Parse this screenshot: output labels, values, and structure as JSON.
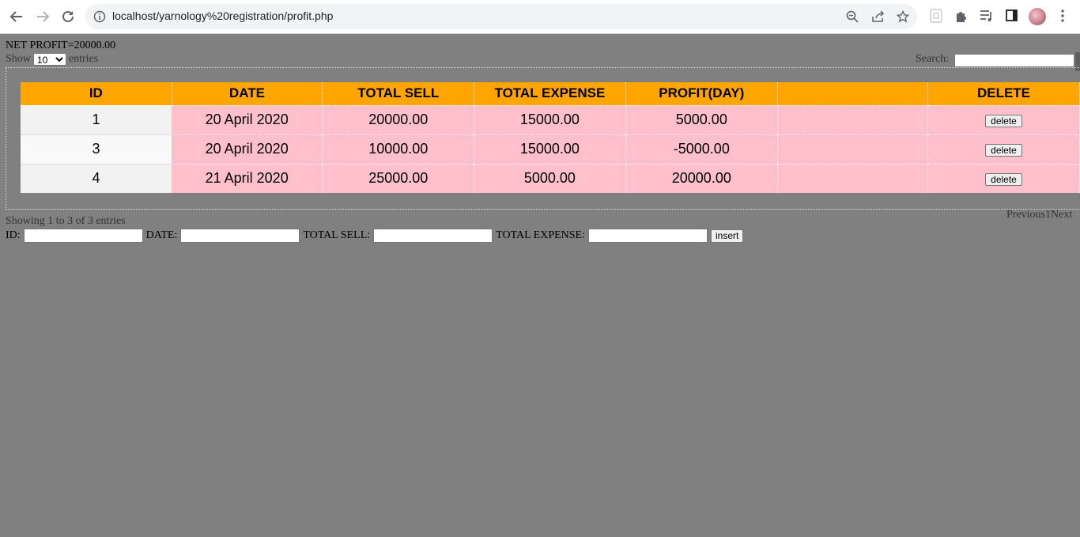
{
  "browser": {
    "url": "localhost/yarnology%20registration/profit.php"
  },
  "page": {
    "net_profit": "NET PROFIT=20000.00",
    "show_label": "Show",
    "show_value": "10",
    "entries_label": "entries",
    "search_label": "Search:",
    "search_value": "",
    "showing_text": "Showing 1 to 3 of 3 entries",
    "paginate": {
      "previous": "Previous",
      "page": "1",
      "next": "Next"
    }
  },
  "table": {
    "headers": [
      "ID",
      "DATE",
      "TOTAL SELL",
      "TOTAL EXPENSE",
      "PROFIT(DAY)",
      "",
      "DELETE"
    ],
    "rows": [
      {
        "id": "1",
        "date": "20 April 2020",
        "sell": "20000.00",
        "expense": "15000.00",
        "profit": "5000.00",
        "delete": "delete"
      },
      {
        "id": "3",
        "date": "20 April 2020",
        "sell": "10000.00",
        "expense": "15000.00",
        "profit": "-5000.00",
        "delete": "delete"
      },
      {
        "id": "4",
        "date": "21 April 2020",
        "sell": "25000.00",
        "expense": "5000.00",
        "profit": "20000.00",
        "delete": "delete"
      }
    ]
  },
  "form": {
    "id_label": "ID:",
    "date_label": "DATE:",
    "sell_label": "TOTAL SELL:",
    "expense_label": "TOTAL EXPENSE:",
    "insert_label": "insert"
  },
  "colors": {
    "page_bg": "#808080",
    "header_bg": "#ffa500",
    "cell_bg": "#ffc0cb"
  }
}
